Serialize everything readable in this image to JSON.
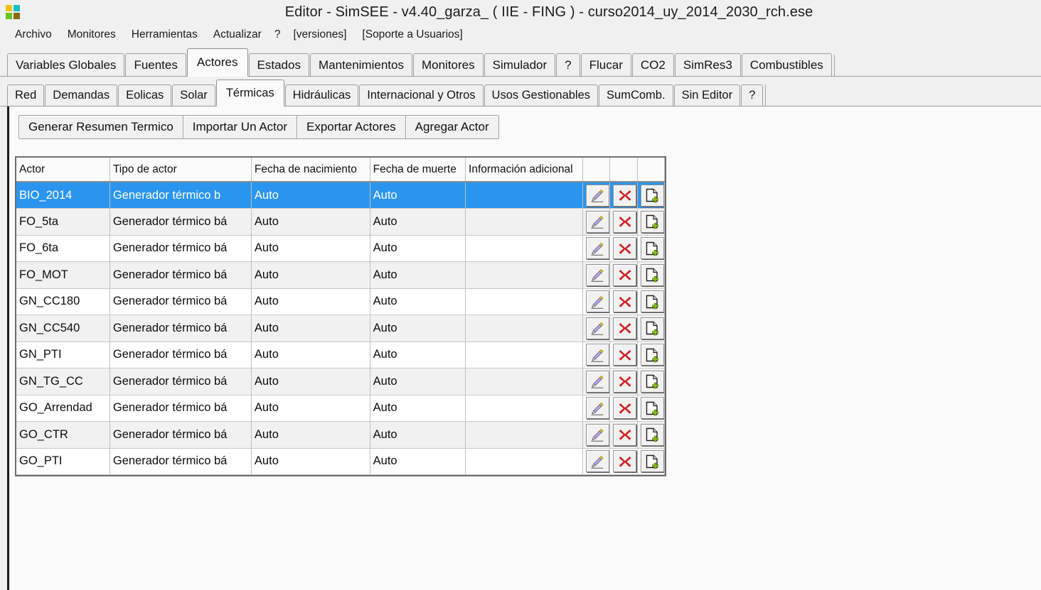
{
  "window": {
    "title": "Editor - SimSEE - v4.40_garza_ ( IIE - FING ) - curso2014_uy_2014_2030_rch.ese",
    "icon": "simsee-squares-icon"
  },
  "menubar": {
    "items": [
      {
        "label": "Archivo"
      },
      {
        "label": "Monitores"
      },
      {
        "label": "Herramientas"
      },
      {
        "label": "Actualizar"
      },
      {
        "label": "?"
      },
      {
        "label": "[versiones]"
      },
      {
        "label": "[Soporte a Usuarios]"
      }
    ]
  },
  "tabs_primary": {
    "active": "Actores",
    "items": [
      {
        "label": "Variables Globales"
      },
      {
        "label": "Fuentes"
      },
      {
        "label": "Actores"
      },
      {
        "label": "Estados"
      },
      {
        "label": "Mantenimientos"
      },
      {
        "label": "Monitores"
      },
      {
        "label": "Simulador"
      },
      {
        "label": "?"
      },
      {
        "label": "Flucar"
      },
      {
        "label": "CO2"
      },
      {
        "label": "SimRes3"
      },
      {
        "label": "Combustibles"
      }
    ]
  },
  "tabs_secondary": {
    "active": "Térmicas",
    "items": [
      {
        "label": "Red"
      },
      {
        "label": "Demandas"
      },
      {
        "label": "Eolicas"
      },
      {
        "label": "Solar"
      },
      {
        "label": "Térmicas"
      },
      {
        "label": "Hidráulicas"
      },
      {
        "label": "Internacional y Otros"
      },
      {
        "label": "Usos Gestionables"
      },
      {
        "label": "SumComb."
      },
      {
        "label": "Sin Editor"
      },
      {
        "label": "?"
      }
    ]
  },
  "toolbar": {
    "buttons": [
      {
        "label": "Generar Resumen Termico"
      },
      {
        "label": "Importar Un Actor"
      },
      {
        "label": "Exportar Actores"
      },
      {
        "label": "Agregar Actor"
      }
    ]
  },
  "table": {
    "columns": [
      "Actor",
      "Tipo de actor",
      "Fecha de nacimiento",
      "Fecha de muerte",
      "Información adicional"
    ],
    "action_icons": [
      "edit-pencil-icon",
      "delete-x-icon",
      "duplicate-page-icon"
    ],
    "selected_row_index": 0,
    "selection_color": "#2a95ef",
    "rows": [
      {
        "actor": "BIO_2014",
        "tipo": "Generador térmico b",
        "nacimiento": "Auto",
        "muerte": "Auto",
        "info": ""
      },
      {
        "actor": "FO_5ta",
        "tipo": "Generador térmico bá",
        "nacimiento": "Auto",
        "muerte": "Auto",
        "info": ""
      },
      {
        "actor": "FO_6ta",
        "tipo": "Generador térmico bá",
        "nacimiento": "Auto",
        "muerte": "Auto",
        "info": ""
      },
      {
        "actor": "FO_MOT",
        "tipo": "Generador térmico bá",
        "nacimiento": "Auto",
        "muerte": "Auto",
        "info": ""
      },
      {
        "actor": "GN_CC180",
        "tipo": "Generador térmico bá",
        "nacimiento": "Auto",
        "muerte": "Auto",
        "info": ""
      },
      {
        "actor": "GN_CC540",
        "tipo": "Generador térmico bá",
        "nacimiento": "Auto",
        "muerte": "Auto",
        "info": ""
      },
      {
        "actor": "GN_PTI",
        "tipo": "Generador térmico bá",
        "nacimiento": "Auto",
        "muerte": "Auto",
        "info": ""
      },
      {
        "actor": "GN_TG_CC",
        "tipo": "Generador térmico bá",
        "nacimiento": "Auto",
        "muerte": "Auto",
        "info": ""
      },
      {
        "actor": "GO_Arrendad",
        "tipo": "Generador térmico bá",
        "nacimiento": "Auto",
        "muerte": "Auto",
        "info": ""
      },
      {
        "actor": "GO_CTR",
        "tipo": "Generador térmico bá",
        "nacimiento": "Auto",
        "muerte": "Auto",
        "info": ""
      },
      {
        "actor": "GO_PTI",
        "tipo": "Generador térmico bá",
        "nacimiento": "Auto",
        "muerte": "Auto",
        "info": ""
      }
    ]
  }
}
